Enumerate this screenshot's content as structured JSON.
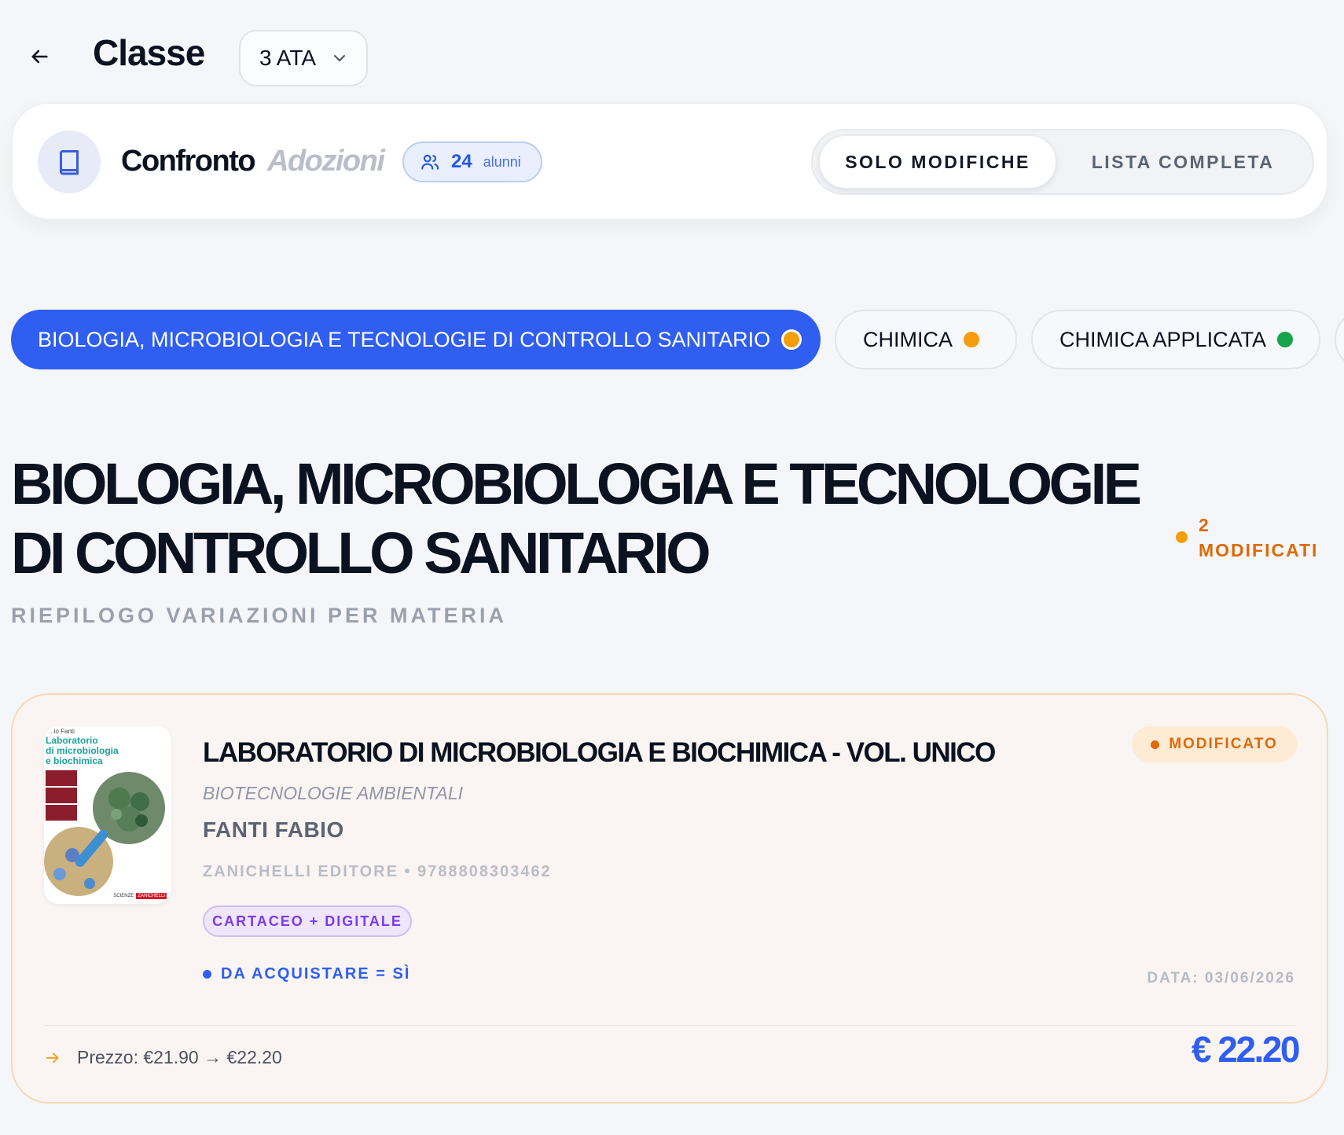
{
  "header": {
    "title": "Classe",
    "class_select": {
      "value": "3 ATA"
    }
  },
  "compare": {
    "title_main": "Confronto",
    "title_accent": "Adozioni",
    "students_count": "24",
    "students_label": "alunni",
    "toggle": {
      "active": "SOLO MODIFICHE",
      "inactive": "LISTA COMPLETA"
    }
  },
  "subjects": [
    {
      "label": "BIOLOGIA, MICROBIOLOGIA E TECNOLOGIE DI CONTROLLO SANITARIO",
      "status_color": "#f59e0b",
      "active": true
    },
    {
      "label": "CHIMICA",
      "status_color": "#f59e0b",
      "active": false
    },
    {
      "label": "CHIMICA APPLICATA",
      "status_color": "#16a34a",
      "active": false
    }
  ],
  "subject": {
    "title": "BIOLOGIA, MICROBIOLOGIA E TECNOLOGIE DI CONTROLLO SANITARIO",
    "modified_count": "2",
    "modified_label": "MODIFICATI",
    "subtitle": "RIEPILOGO VARIAZIONI PER MATERIA"
  },
  "book": {
    "cover": {
      "author": "...io Fanti",
      "title_lines": [
        "Laboratorio",
        "di microbiologia",
        "e biochimica"
      ],
      "brand": "SCIENZE",
      "publisher_mark": "ZANICHELLI"
    },
    "title": "LABORATORIO DI MICROBIOLOGIA E BIOCHIMICA - VOL. UNICO",
    "subtitle": "BIOTECNOLOGIE AMBIENTALI",
    "author": "FANTI FABIO",
    "meta": "ZANICHELLI EDITORE • 9788808303462",
    "format": "CARTACEO + DIGITALE",
    "purchase": "DA ACQUISTARE = SÌ",
    "status": "MODIFICATO",
    "date": "DATA: 03/06/2026",
    "price_change": "Prezzo: €21.90 → €22.20",
    "price": "€ 22.20"
  },
  "colors": {
    "accent": "#2f5ef0",
    "warning": "#dd6a06",
    "success": "#16a34a",
    "format_purple": "#7c3aed"
  },
  "icons": [
    "back-arrow-icon",
    "chevron-down-icon",
    "book-icon",
    "users-icon",
    "status-dot-icon",
    "arrow-right-icon"
  ]
}
